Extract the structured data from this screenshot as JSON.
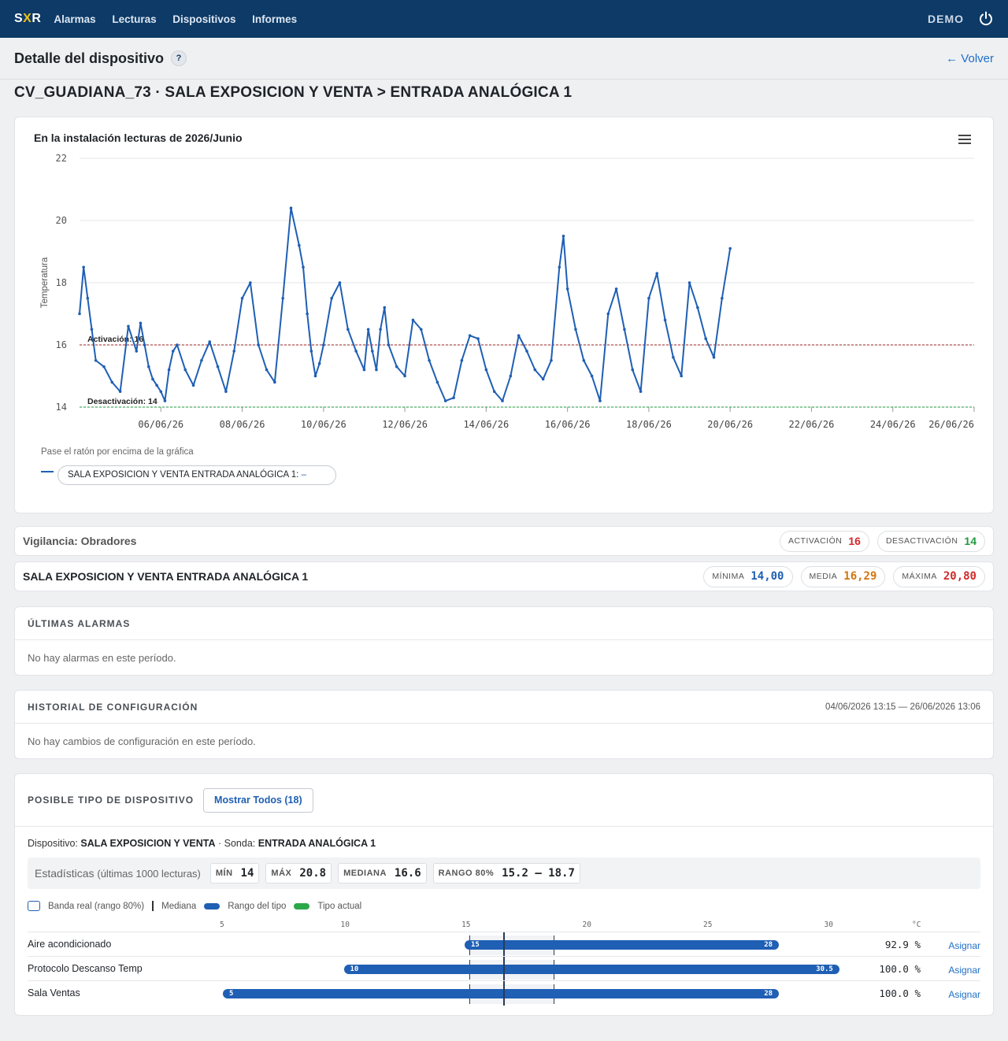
{
  "nav": {
    "logo": "SXR",
    "items": [
      "Alarmas",
      "Lecturas",
      "Dispositivos",
      "Informes"
    ],
    "user": "DEMO"
  },
  "header": {
    "title": "Detalle del dispositivo",
    "help": "?",
    "back": "← Volver"
  },
  "device_title": "CV_GUADIANA_73 · SALA EXPOSICION Y VENTA > ENTRADA ANALÓGICA 1",
  "chart_data": {
    "type": "line",
    "title": "En la instalación lecturas de 2026/Junio",
    "ylabel": "Temperatura",
    "ylim": [
      14,
      22
    ],
    "yticks": [
      "14",
      "16",
      "18",
      "20",
      "22"
    ],
    "xticks": [
      "06/06/26",
      "08/06/26",
      "10/06/26",
      "12/06/26",
      "14/06/26",
      "16/06/26",
      "18/06/26",
      "20/06/26",
      "22/06/26",
      "24/06/26",
      "26/06/26"
    ],
    "xlim_days": [
      "04/06/26",
      "26/06/26"
    ],
    "series": [
      {
        "name": "SALA EXPOSICION Y VENTA ENTRADA ANALÓGICA 1",
        "color": "#1f5fb4",
        "x_day": [
          4.0,
          4.1,
          4.2,
          4.3,
          4.4,
          4.6,
          4.8,
          5.0,
          5.2,
          5.4,
          5.5,
          5.6,
          5.7,
          5.8,
          5.9,
          6.0,
          6.1,
          6.2,
          6.3,
          6.4,
          6.6,
          6.8,
          7.0,
          7.2,
          7.4,
          7.6,
          7.8,
          8.0,
          8.2,
          8.4,
          8.6,
          8.8,
          9.0,
          9.2,
          9.4,
          9.5,
          9.6,
          9.7,
          9.8,
          9.9,
          10.0,
          10.2,
          10.4,
          10.6,
          10.8,
          11.0,
          11.1,
          11.2,
          11.3,
          11.4,
          11.5,
          11.6,
          11.8,
          12.0,
          12.2,
          12.4,
          12.6,
          12.8,
          13.0,
          13.2,
          13.4,
          13.6,
          13.8,
          14.0,
          14.2,
          14.4,
          14.6,
          14.8,
          15.0,
          15.2,
          15.4,
          15.6,
          15.8,
          15.9,
          16.0,
          16.2,
          16.4,
          16.6,
          16.8,
          17.0,
          17.2,
          17.4,
          17.6,
          17.8,
          18.0,
          18.2,
          18.4,
          18.6,
          18.8,
          19.0,
          19.2,
          19.4,
          19.6,
          19.8,
          20.0
        ],
        "y": [
          17.0,
          18.5,
          17.5,
          16.5,
          15.5,
          15.3,
          14.8,
          14.5,
          16.6,
          15.8,
          16.7,
          16.0,
          15.3,
          14.9,
          14.7,
          14.5,
          14.2,
          15.2,
          15.8,
          16.0,
          15.2,
          14.7,
          15.5,
          16.1,
          15.3,
          14.5,
          15.8,
          17.5,
          18.0,
          16.0,
          15.2,
          14.8,
          17.5,
          20.4,
          19.2,
          18.5,
          17.0,
          15.8,
          15.0,
          15.4,
          16.0,
          17.5,
          18.0,
          16.5,
          15.8,
          15.2,
          16.5,
          15.8,
          15.2,
          16.5,
          17.2,
          16.0,
          15.3,
          15.0,
          16.8,
          16.5,
          15.5,
          14.8,
          14.2,
          14.3,
          15.5,
          16.3,
          16.2,
          15.2,
          14.5,
          14.2,
          15.0,
          16.3,
          15.8,
          15.2,
          14.9,
          15.5,
          18.5,
          19.5,
          17.8,
          16.5,
          15.5,
          15.0,
          14.2,
          17.0,
          17.8,
          16.5,
          15.2,
          14.5,
          17.5,
          18.3,
          16.8,
          15.6,
          15.0,
          18.0,
          17.2,
          16.2,
          15.6,
          17.5,
          19.1
        ]
      }
    ],
    "threshold_lines": [
      {
        "label": "Activación: 16",
        "value": 16,
        "color": "#a02020"
      },
      {
        "label": "Desactivación: 14",
        "value": 14,
        "color": "#1f9a3f"
      }
    ]
  },
  "chart_ui": {
    "hover_hint": "Pase el ratón por encima de la gráfica",
    "legend_label": "SALA EXPOSICION Y VENTA ENTRADA ANALÓGICA 1:",
    "legend_value": "–"
  },
  "vigilancia": {
    "label": "Vigilancia:",
    "value": "Obradores",
    "activacion_label": "ACTIVACIÓN",
    "activacion": "16",
    "desactivacion_label": "DESACTIVACIÓN",
    "desactivacion": "14"
  },
  "summary": {
    "name": "SALA EXPOSICION Y VENTA ENTRADA ANALÓGICA 1",
    "min_label": "MÍNIMA",
    "min": "14,00",
    "avg_label": "MEDIA",
    "avg": "16,29",
    "max_label": "MÁXIMA",
    "max": "20,80"
  },
  "alarms": {
    "title": "ÚLTIMAS ALARMAS",
    "empty": "No hay alarmas en este período."
  },
  "config_history": {
    "title": "HISTORIAL DE CONFIGURACIÓN",
    "range": "04/06/2026 13:15 — 26/06/2026 13:06",
    "empty": "No hay cambios de configuración en este período."
  },
  "device_type": {
    "title": "POSIBLE TIPO DE DISPOSITIVO",
    "show_all": "Mostrar Todos (18)",
    "device_label": "Dispositivo:",
    "device": "SALA EXPOSICION Y VENTA",
    "probe_label": "· Sonda:",
    "probe": "ENTRADA ANALÓGICA 1",
    "stats_title": "Estadísticas",
    "stats_sub": "(últimas 1000 lecturas)",
    "stats": [
      {
        "k": "MÍN",
        "v": "14"
      },
      {
        "k": "MÁX",
        "v": "20.8"
      },
      {
        "k": "MEDIANA",
        "v": "16.6"
      },
      {
        "k": "RANGO 80%",
        "v": "15.2 — 18.7"
      }
    ],
    "legend": {
      "band": "Banda real (rango 80%)",
      "median": "Mediana",
      "range": "Rango del tipo",
      "current": "Tipo actual"
    },
    "scale": {
      "ticks": [
        "5",
        "10",
        "15",
        "20",
        "25",
        "30"
      ],
      "unit": "°C"
    },
    "band": {
      "low": 15.2,
      "high": 18.7,
      "median": 16.6
    },
    "rows": [
      {
        "name": "Aire acondicionado",
        "min": "15",
        "max": "28",
        "pct": "92.9 %",
        "assign": "Asignar"
      },
      {
        "name": "Protocolo Descanso Temp",
        "min": "10",
        "max": "30.5",
        "pct": "100.0 %",
        "assign": "Asignar"
      },
      {
        "name": "Sala Ventas",
        "min": "5",
        "max": "28",
        "pct": "100.0 %",
        "assign": "Asignar"
      }
    ]
  }
}
